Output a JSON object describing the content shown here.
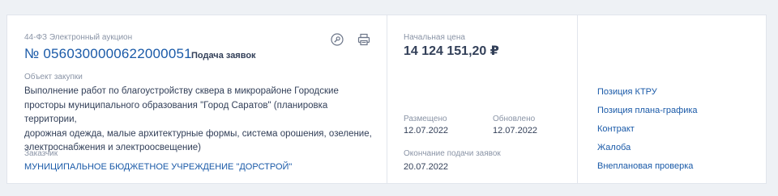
{
  "procedure": {
    "type": "44-ФЗ Электронный аукцион",
    "number": "№ 0560300000622000051",
    "status": "Подача заявок"
  },
  "icons": {
    "watch": "badge-icon",
    "print": "printer-icon"
  },
  "subject": {
    "label": "Объект закупки",
    "lines": [
      "Выполнение работ по благоустройству сквера в микрорайоне Городские",
      "просторы муниципального образования \"Город Саратов\" (планировка территории,",
      "дорожная одежда, малые архитектурные формы, система орошения, озеление,",
      "электроснабжения и электроосвещение)"
    ]
  },
  "customer": {
    "label": "Заказчик",
    "name": "МУНИЦИПАЛЬНОЕ БЮДЖЕТНОЕ УЧРЕЖДЕНИЕ \"ДОРСТРОЙ\""
  },
  "price": {
    "label": "Начальная цена",
    "value": "14 124 151,20 ₽"
  },
  "dates": {
    "placed_label": "Размещено",
    "placed_value": "12.07.2022",
    "updated_label": "Обновлено",
    "updated_value": "12.07.2022",
    "end_label": "Окончание подачи заявок",
    "end_value": "20.07.2022"
  },
  "links": [
    "Позиция КТРУ",
    "Позиция плана-графика",
    "Контракт",
    "Жалоба",
    "Внеплановая проверка"
  ],
  "colors": {
    "link": "#1a5aa8",
    "text": "#334059",
    "muted": "#8a94a6",
    "border": "#e1e5ec"
  }
}
